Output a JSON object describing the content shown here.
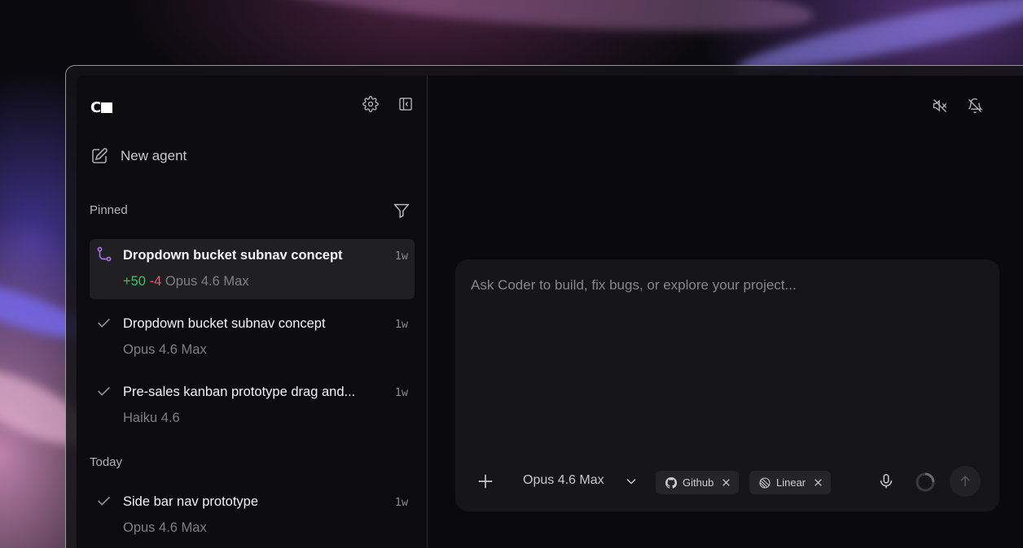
{
  "app": {
    "logo_text": "C"
  },
  "sidebar": {
    "settings_icon": "gear-icon",
    "collapse_icon": "sidebar-collapse-icon",
    "new_agent_label": "New agent",
    "pinned_label": "Pinned",
    "today_label": "Today",
    "pinned_items": [
      {
        "title": "Dropdown bucket subnav concept",
        "additions": "+50",
        "deletions": "-4",
        "model": "Opus 4.6 Max",
        "time": "1w",
        "status": "branch",
        "active": true
      },
      {
        "title": "Dropdown bucket subnav concept",
        "model": "Opus 4.6 Max",
        "time": "1w",
        "status": "done"
      },
      {
        "title": "Pre-sales kanban prototype drag and...",
        "model": "Haiku 4.6",
        "time": "1w",
        "status": "done"
      }
    ],
    "today_items": [
      {
        "title": "Side bar nav prototype",
        "model": "Opus 4.6 Max",
        "time": "1w",
        "status": "done"
      }
    ]
  },
  "header": {
    "icons": [
      "speaker-muted-icon",
      "bell-off-icon"
    ]
  },
  "composer": {
    "placeholder": "Ask Coder to build, fix bugs, or explore your project...",
    "model_label": "Opus 4.6 Max",
    "chips": [
      {
        "label": "Github",
        "icon": "github-icon"
      },
      {
        "label": "Linear",
        "icon": "linear-icon"
      }
    ]
  },
  "colors": {
    "accent_purple": "#a970e6",
    "add_green": "#3fbf6a",
    "delete_red": "#e06070"
  }
}
